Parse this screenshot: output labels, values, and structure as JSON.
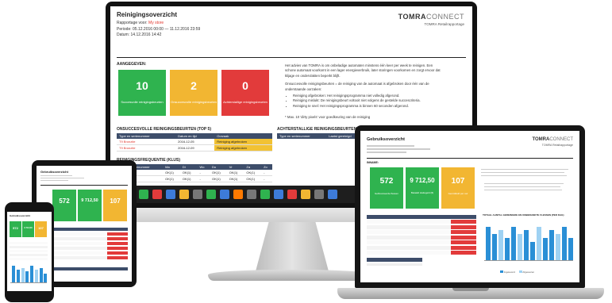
{
  "desktop": {
    "title": "Reinigingsoverzicht",
    "meta": {
      "rapportage_label": "Rapportage voor:",
      "rapportage_value": "My store",
      "periode": "Periode: 05.12.2016 00:00 — 11.12.2016 23:59",
      "datum": "Datum: 14.12.2016 14:42"
    },
    "brand": {
      "strong": "TOMRA",
      "light": "CONNECT",
      "sub": "TOMRA Retailrapportage"
    },
    "section_label": "AANGEGEVEN:",
    "kpis": [
      {
        "value": "10",
        "caption": "Succesvolle reinigingsbeurten",
        "color": "#2fb34f"
      },
      {
        "value": "2",
        "caption": "Onsuccesvolle reinigingsbeurten",
        "color": "#f2b632"
      },
      {
        "value": "0",
        "caption": "Achterstallige reinigingsbeurten",
        "color": "#e23b3b"
      }
    ],
    "right_text": {
      "p1": "Het advies van TOMRA is om onbeladige automaten minstens één keer per week te reinigen. Een schone automaat voorkomt in een lager energieverbruik, later storingen voorkomen en zorgt ervoor dat klijage en ondervlakten beperkt blijft.",
      "p2": "Onsuccesvolle reinigingsbeurten = de reiniging van de automaat is afgebroken door één van de onderstaande oorzaken:",
      "bullets": [
        "Reiniging afgebroken: Het reinigingsprogramma niet volledig afgerond.",
        "Reiniging mislukt: De reinigingsbeurt voltooit niet volgens de gestelde succescriteria.",
        "Reiniging te snel: Het reinigingsprogramma is binnen 60 seconden afgerond."
      ],
      "note": "* Max. 10 'dirty pixels' voor goedkeuring van de reiniging"
    },
    "table1": {
      "title": "ONSUCCESVOLLE REINIGINGSBEURTEN (TOP 5)",
      "headers": [
        "Type en serienummer",
        "Datum en tijd",
        "Oorzaak"
      ],
      "rows": [
        [
          "T9 Bronzite",
          "2016-12-05",
          "Reiniging afgebroken"
        ],
        [
          "T9 Bronzite",
          "2016-12-09",
          "Reiniging afgebroken"
        ]
      ]
    },
    "table2": {
      "title": "ACHTERSTALLIGE REINIGINGSBEURTEN",
      "headers": [
        "Type en serienummer",
        "Laatst gereinigd"
      ]
    },
    "table3": {
      "title": "REINIGINGSFREQUENTIE (KLUS)",
      "headers": [
        "Type en serienummer",
        "Ma",
        "Di",
        "Wo",
        "Do",
        "Vr",
        "Za",
        "Zo"
      ],
      "rows": [
        [
          "T9 Bronzite",
          "OK(1)",
          "OK(1)",
          "-",
          "OK(1)",
          "OK(1)",
          "OK(1)",
          "-"
        ],
        [
          "T9 Bronzite",
          "OK(1)",
          "OK(1)",
          "-",
          "OK(1)",
          "OK(1)",
          "OK(1)",
          "-"
        ]
      ]
    },
    "taskbar_icons": [
      "#2fb34f",
      "#e23b3b",
      "#3d7bd9",
      "#f2b632",
      "#777777",
      "#2fb34f",
      "#3d7bd9",
      "#ff7a00",
      "#777777",
      "#2fb34f",
      "#3d7bd9",
      "#e23b3b",
      "#f2b632",
      "#777777",
      "#3d7bd9"
    ]
  },
  "laptop": {
    "title": "Gebruiksoverzicht",
    "brand": {
      "strong": "TOMRA",
      "light": "CONNECT",
      "sub": "TOMRA Retailrapportage"
    },
    "section_label": "INNAME:",
    "kpis": [
      {
        "value": "572",
        "caption": "Gefinanceerde flessen",
        "color": "#2fb34f"
      },
      {
        "value": "9 712,50",
        "caption": "Betaald statiegeld (€)",
        "color": "#2fb34f"
      },
      {
        "value": "107",
        "caption": "Gemiddeld per uur",
        "color": "#f2b632"
      }
    ],
    "chart_title": "TOTAAL AANTAL GEREINIGDE EN ONBEDANKTE FLESSEN (PER DAG)",
    "chart_bars": [
      9,
      7,
      8,
      6,
      9,
      7,
      8,
      5,
      9,
      6,
      8,
      7,
      9,
      6
    ],
    "legend": [
      "Ingeleverd",
      "Afgewezen"
    ]
  },
  "tablet": {
    "title": "Gebruiksoverzicht",
    "kpis": [
      {
        "value": "572",
        "color": "#2fb34f"
      },
      {
        "value": "9 712,50",
        "color": "#2fb34f"
      },
      {
        "value": "107",
        "color": "#f2b632"
      }
    ]
  },
  "phone": {
    "title": "Gebruiksoverzicht",
    "kpis": [
      {
        "value": "572",
        "color": "#2fb34f"
      },
      {
        "value": "9 712,50",
        "color": "#2fb34f"
      },
      {
        "value": "107",
        "color": "#f2b632"
      }
    ]
  }
}
